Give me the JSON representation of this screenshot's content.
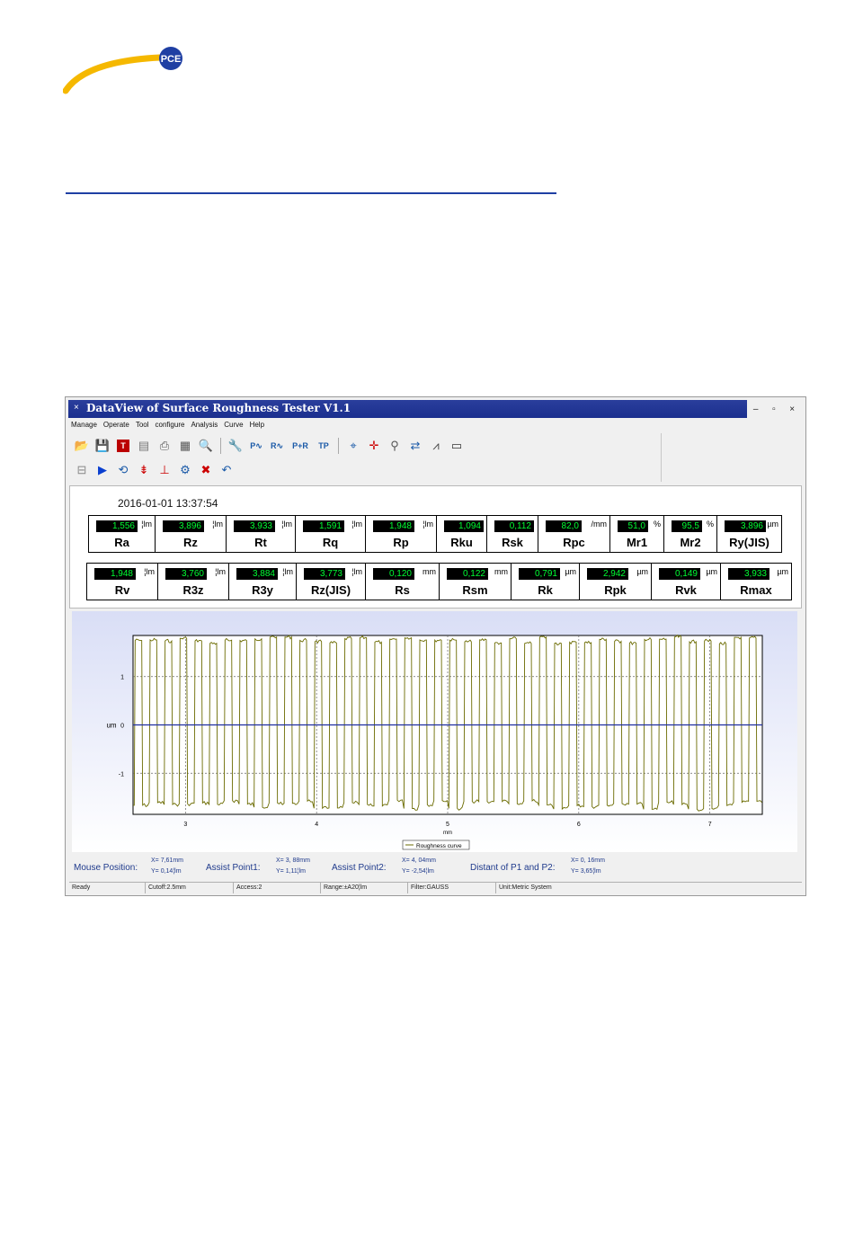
{
  "logo": {
    "text": "PCE"
  },
  "window": {
    "title": "DataView of Surface Roughness Tester  V1.1",
    "controls": [
      "–",
      "▫",
      "×"
    ]
  },
  "menu": [
    "Manage",
    "Operate",
    "Tool",
    "configure",
    "Analysis",
    "Curve",
    "Help"
  ],
  "toolbar": {
    "row1": [
      "open-folder",
      "save",
      "T",
      "database",
      "print",
      "report",
      "print-preview",
      "settings",
      "P",
      "R",
      "P+R",
      "TP",
      "crosshair",
      "crosshair-red",
      "zoom",
      "refresh",
      "graph",
      "monitor"
    ],
    "row2": [
      "device",
      "play",
      "sync",
      "scale",
      "leveling",
      "tools",
      "delete",
      "undo"
    ],
    "labels": {
      "P": "P",
      "R": "R",
      "PR": "P+R",
      "TP": "TP",
      "T": "T"
    }
  },
  "timestamp": "2016-01-01 13:37:54",
  "params_row1": [
    {
      "value": "1,556",
      "unit": "¦lm",
      "name": "Ra"
    },
    {
      "value": "3,896",
      "unit": "¦lm",
      "name": "Rz"
    },
    {
      "value": "3,933",
      "unit": "¦lm",
      "name": "Rt"
    },
    {
      "value": "1,591",
      "unit": "¦lm",
      "name": "Rq"
    },
    {
      "value": "1,948",
      "unit": "¦lm",
      "name": "Rp"
    },
    {
      "value": "1,094",
      "unit": "",
      "name": "Rku"
    },
    {
      "value": "0,112",
      "unit": "",
      "name": "Rsk"
    },
    {
      "value": "82,0",
      "unit": "/mm",
      "name": "Rpc"
    },
    {
      "value": "51,0",
      "unit": "%",
      "name": "Mr1"
    },
    {
      "value": "95,5",
      "unit": "%",
      "name": "Mr2"
    },
    {
      "value": "3,896",
      "unit": "µm",
      "name": "Ry(JIS)"
    }
  ],
  "params_row2": [
    {
      "value": "1,948",
      "unit": "¦lm",
      "name": "Rv"
    },
    {
      "value": "3,760",
      "unit": "¦lm",
      "name": "R3z"
    },
    {
      "value": "3,884",
      "unit": "¦lm",
      "name": "R3y"
    },
    {
      "value": "3,773",
      "unit": "¦lm",
      "name": "Rz(JIS)"
    },
    {
      "value": "0,120",
      "unit": "mm",
      "name": "Rs"
    },
    {
      "value": "0,122",
      "unit": "mm",
      "name": "Rsm"
    },
    {
      "value": "0,791",
      "unit": "µm",
      "name": "Rk"
    },
    {
      "value": "2,942",
      "unit": "µm",
      "name": "Rpk"
    },
    {
      "value": "0,149",
      "unit": "µm",
      "name": "Rvk"
    },
    {
      "value": "3,933",
      "unit": "µm",
      "name": "Rmax"
    }
  ],
  "chart_data": {
    "type": "line",
    "series": [
      {
        "name": "Roughness curve",
        "color": "#6b6b00"
      }
    ],
    "xlabel": "mm",
    "ylabel": "um",
    "xticks": [
      3,
      4,
      5,
      6,
      7
    ],
    "yticks": [
      1,
      0,
      -1
    ],
    "xlim": [
      2.6,
      7.4
    ],
    "ylim": [
      -1.85,
      1.85
    ],
    "wave": {
      "cycles": 42,
      "high": 1.82,
      "low": -1.55
    },
    "grid": "dotted",
    "legend": "bottom-center"
  },
  "mouse_info": {
    "mouse_position": {
      "label": "Mouse Position:",
      "x": "X=   7,61mm",
      "y": "Y=   0,14¦lm"
    },
    "assist1": {
      "label": "Assist Point1:",
      "x": "X=   3, 88mm",
      "y": "Y=   1,11¦lm"
    },
    "assist2": {
      "label": "Assist Point2:",
      "x": "X=   4, 04mm",
      "y": "Y=  -2,54¦lm"
    },
    "distance": {
      "label": "Distant of P1 and P2:",
      "x": "X=   0, 16mm",
      "y": "Y=   3,65¦lm"
    }
  },
  "status": [
    "Ready",
    "Cutoff:2.5mm",
    "Access:2",
    "Range:±A20¦lm",
    "Filter:GAUSS",
    "Unit:Metric System"
  ]
}
